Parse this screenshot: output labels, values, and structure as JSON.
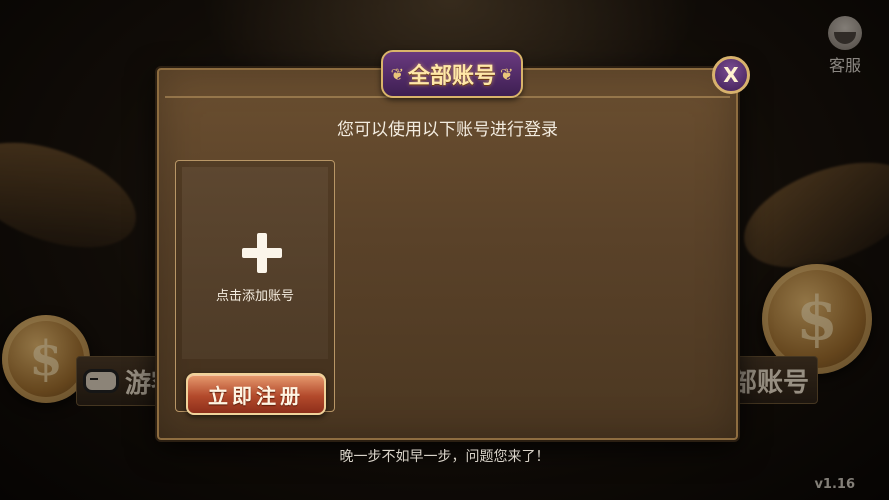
{
  "service": {
    "label": "客服"
  },
  "version": "v1.16",
  "background_buttons": {
    "guest": "游客",
    "all_accounts": "部账号"
  },
  "dialog": {
    "title": "全部账号",
    "close_label": "X",
    "subtitle": "您可以使用以下账号进行登录",
    "add_account_label": "点击添加账号",
    "register_label": "立即注册"
  },
  "footer_tip": "晚一步不如早一步，问题您来了！",
  "colors": {
    "accent": "#d8b26d",
    "badge": "#4e2866",
    "register": "#b34a2c"
  }
}
